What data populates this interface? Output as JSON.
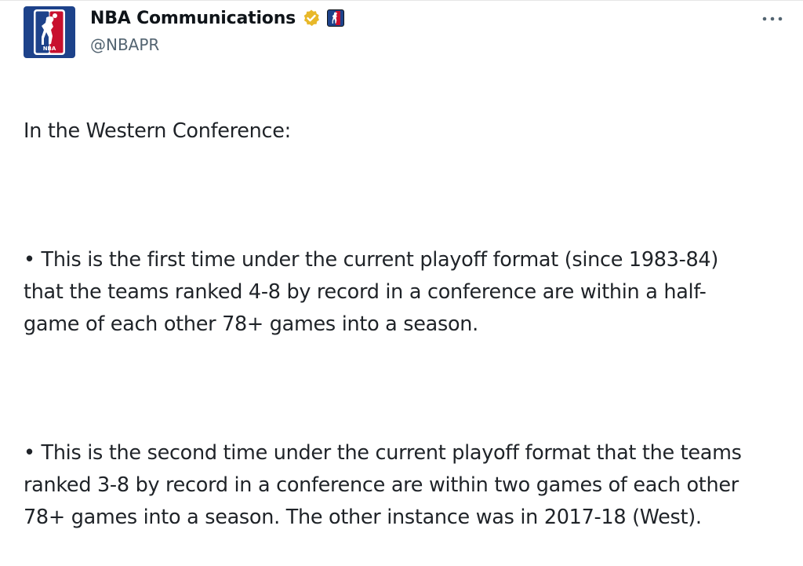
{
  "author": {
    "display_name": "NBA Communications",
    "handle": "@NBAPR",
    "verified_icon": "gold-verified-badge-icon",
    "affiliate_icon": "nba-logo-icon",
    "avatar_icon": "nba-logo-icon"
  },
  "colors": {
    "brand_blue": "#1d428a",
    "brand_red": "#c8102e",
    "verified_gold": "#e8b829",
    "handle_gray": "#536471",
    "text": "#1f2328"
  },
  "tweet": {
    "intro": "In the Western Conference:",
    "bullet_1": "• This is the first time under the current playoff format (since 1983-84)\nthat the teams ranked 4-8 by record in a conference are within a half-\ngame of each other 78+ games into a season.",
    "bullet_2": "• This is the second time under the current playoff format that the teams\nranked 3-8 by record in a conference are within two games of each other\n78+ games into a season. The other instance was in 2017-18 (West)."
  },
  "more_button_icon": "more-horizontal-icon"
}
